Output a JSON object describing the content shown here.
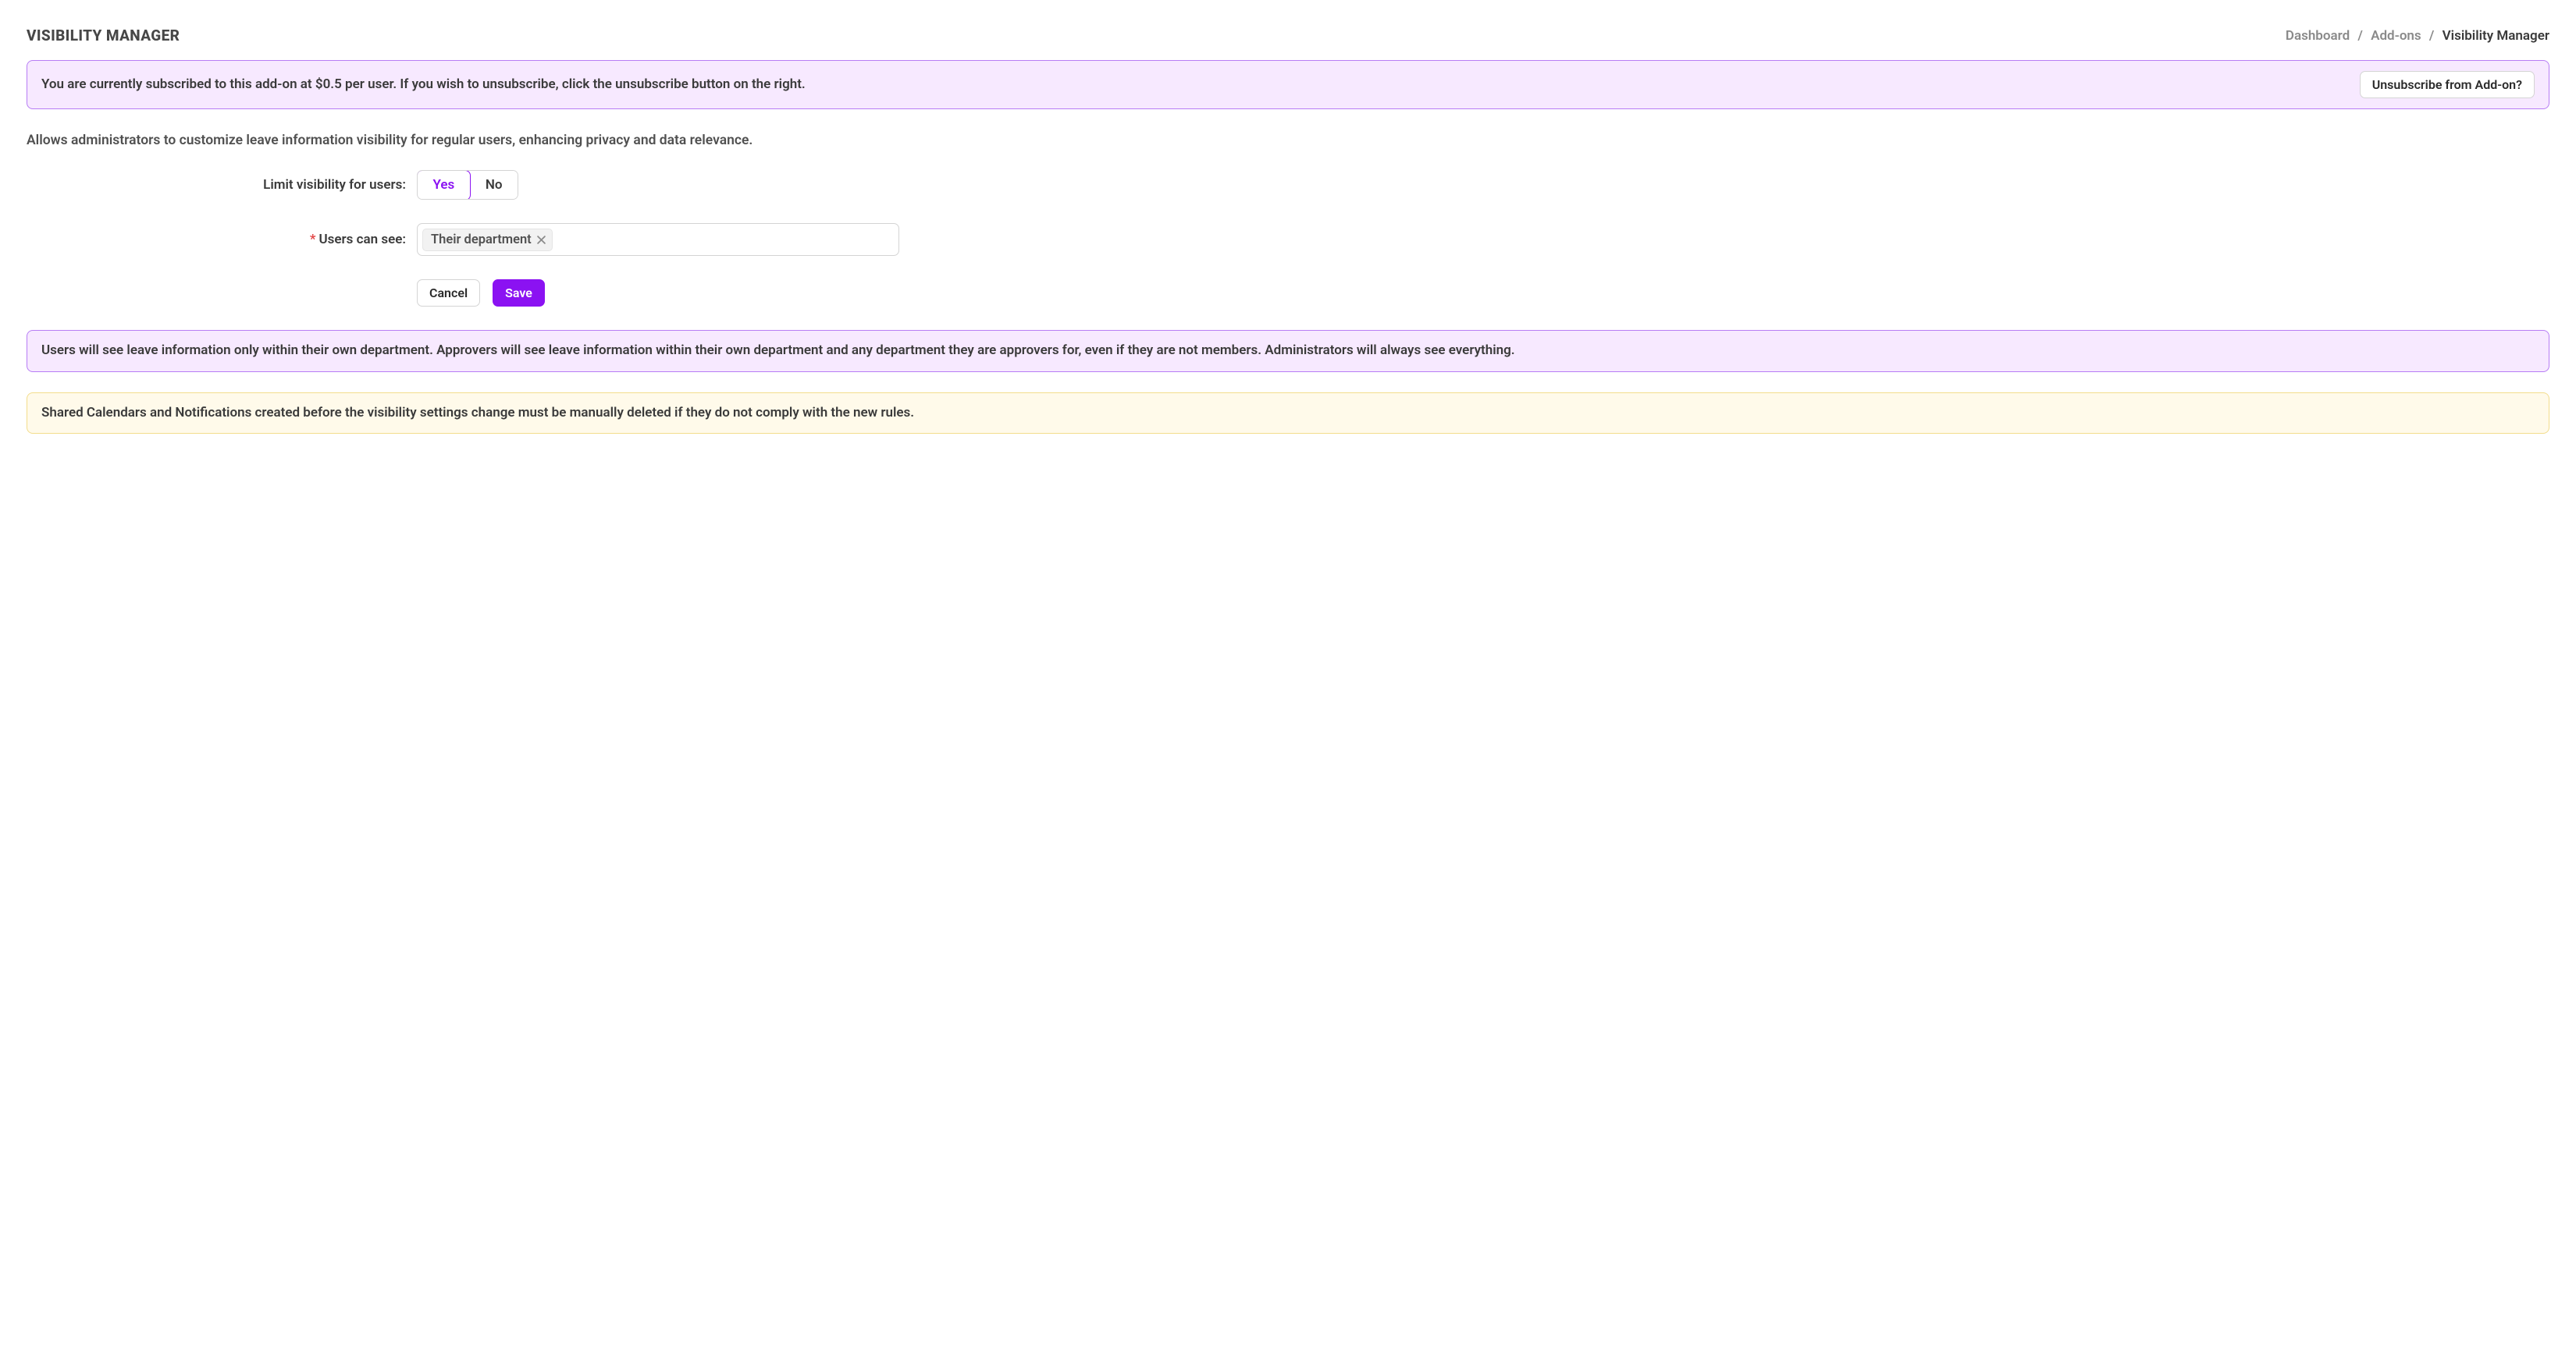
{
  "header": {
    "title": "VISIBILITY MANAGER",
    "breadcrumb": {
      "items": [
        {
          "label": "Dashboard"
        },
        {
          "label": "Add-ons"
        },
        {
          "label": "Visibility Manager"
        }
      ],
      "separator": "/"
    }
  },
  "subscription_alert": {
    "message": "You are currently subscribed to this add-on at $0.5 per user. If you wish to unsubscribe, click the unsubscribe button on the right.",
    "button_label": "Unsubscribe from Add-on?"
  },
  "description": "Allows administrators to customize leave information visibility for regular users, enhancing privacy and data relevance.",
  "form": {
    "limit_label": "Limit visibility for users:",
    "limit_options": {
      "yes": "Yes",
      "no": "No"
    },
    "limit_selected": "yes",
    "can_see_label": "Users can see:",
    "can_see_required": true,
    "can_see_tags": [
      {
        "label": "Their department"
      }
    ],
    "cancel_label": "Cancel",
    "save_label": "Save"
  },
  "info_alert": {
    "message": "Users will see leave information only within their own department. Approvers will see leave information within their own department and any department they are approvers for, even if they are not members. Administrators will always see everything."
  },
  "warning_alert": {
    "message": "Shared Calendars and Notifications created before the visibility settings change must be manually deleted if they do not comply with the new rules."
  },
  "colors": {
    "accent": "#8b12f2",
    "purple_border": "#b77df5",
    "purple_bg": "#f7e9ff",
    "yellow_border": "#f3dd8c",
    "yellow_bg": "#fffaea"
  }
}
